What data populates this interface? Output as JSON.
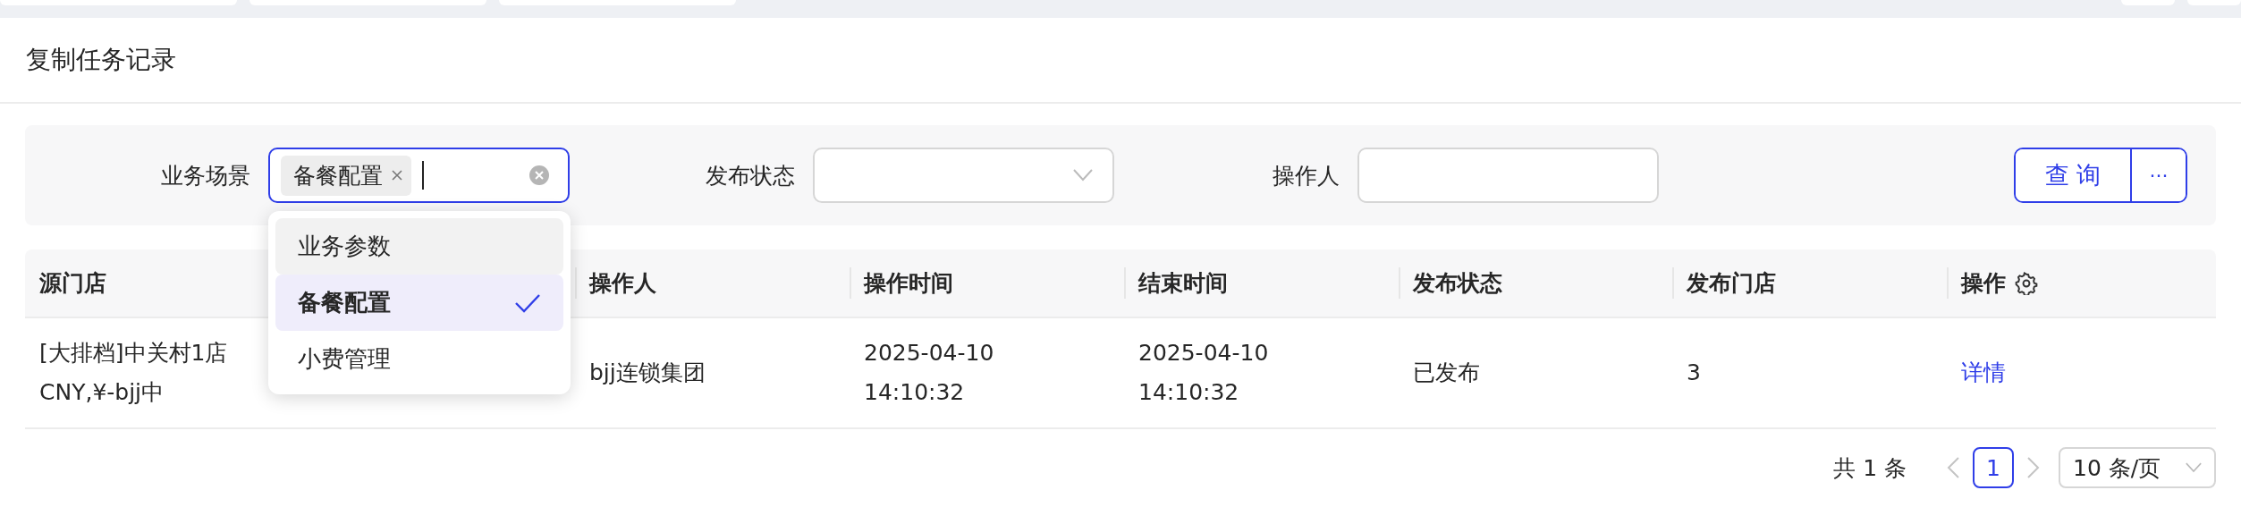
{
  "page_title": "复制任务记录",
  "filters": [
    {
      "kind": "tag-select",
      "label": "业务场景",
      "tags": [
        "备餐配置"
      ],
      "focused": true
    },
    {
      "kind": "select",
      "label": "发布状态",
      "focused": false
    },
    {
      "kind": "input",
      "label": "操作人",
      "focused": false
    }
  ],
  "buttons": {
    "query": "查 询",
    "more": "···"
  },
  "dropdown": {
    "options": [
      {
        "label": "业务参数",
        "selected": false,
        "hovered": true
      },
      {
        "label": "备餐配置",
        "selected": true,
        "hovered": false
      },
      {
        "label": "小费管理",
        "selected": false,
        "hovered": false
      }
    ]
  },
  "table": {
    "columns": [
      "源门店",
      "操作人",
      "操作时间",
      "结束时间",
      "发布状态",
      "发布门店",
      "操作"
    ],
    "rows": [
      {
        "cells": [
          {
            "kind": "text",
            "lines": [
              "[大排档]中关村1店",
              "CNY,¥-bjj中"
            ]
          },
          {
            "kind": "text",
            "lines": [
              "bjj连锁集团"
            ]
          },
          {
            "kind": "text",
            "lines": [
              "2025-04-10",
              "14:10:32"
            ]
          },
          {
            "kind": "text",
            "lines": [
              "2025-04-10",
              "14:10:32"
            ]
          },
          {
            "kind": "text",
            "lines": [
              "已发布"
            ]
          },
          {
            "kind": "text",
            "lines": [
              "3"
            ]
          },
          {
            "kind": "link",
            "lines": [
              "详情"
            ]
          }
        ]
      }
    ]
  },
  "pagination": {
    "total": "共 1 条",
    "pages": [
      {
        "label": "1",
        "selected": true
      }
    ],
    "page_size": "10 条/页"
  }
}
